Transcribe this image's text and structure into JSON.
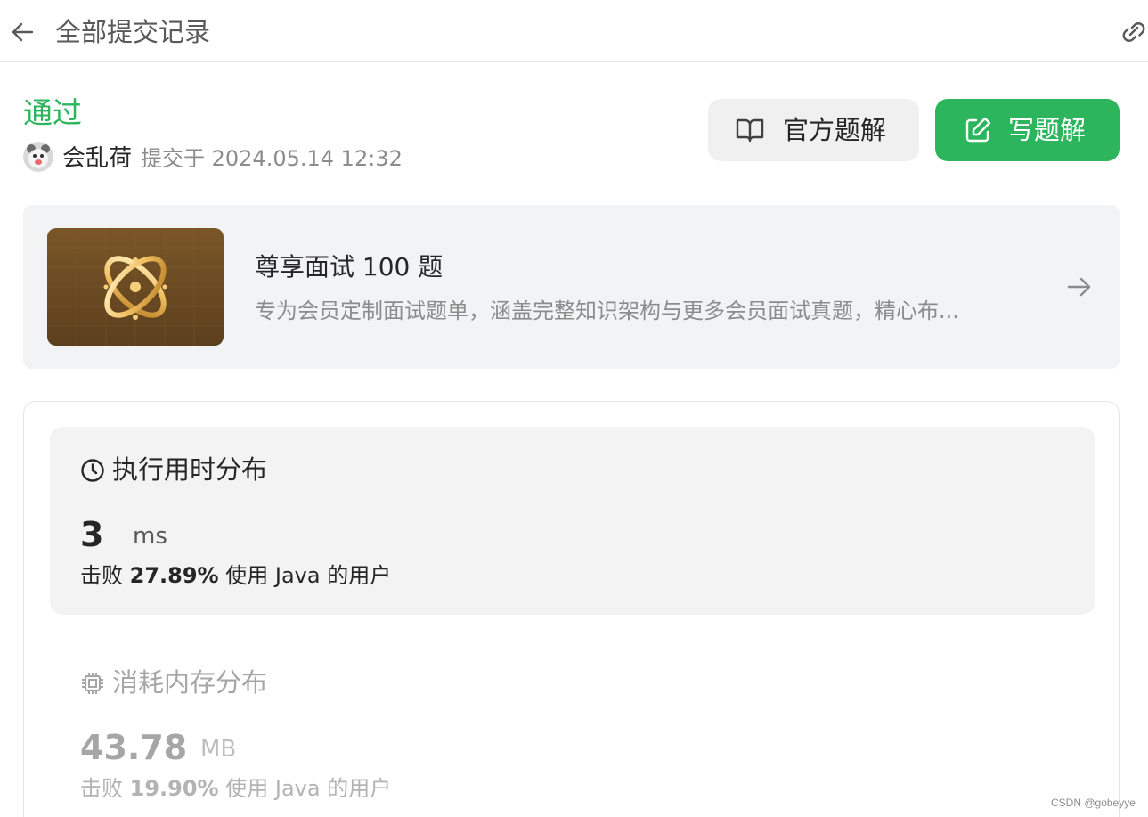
{
  "header": {
    "title": "全部提交记录",
    "back_icon": "arrow-left-icon",
    "share_icon": "link-icon"
  },
  "submission": {
    "status": "通过",
    "username": "会乱荷",
    "submitted_text": "提交于 2024.05.14 12:32"
  },
  "actions": {
    "official_solution_label": "官方题解",
    "write_solution_label": "写题解",
    "official_icon": "book-open-icon",
    "write_icon": "edit-icon"
  },
  "promo": {
    "title": "尊享面试 100 题",
    "description": "专为会员定制面试题单，涵盖完整知识架构与更多会员面试真题，精心布...",
    "arrow_icon": "arrow-right-icon"
  },
  "runtime": {
    "title": "执行用时分布",
    "value": "3",
    "unit": "ms",
    "beat_prefix": "击败",
    "beat_percent": "27.89%",
    "beat_suffix": "使用 Java 的用户",
    "icon": "clock-icon"
  },
  "memory": {
    "title": "消耗内存分布",
    "value": "43.78",
    "unit": "MB",
    "beat_prefix": "击败",
    "beat_percent": "19.90%",
    "beat_suffix": "使用 Java 的用户",
    "icon": "chip-icon"
  },
  "watermark": "CSDN @gobeyye",
  "colors": {
    "accent_green": "#2db55d",
    "panel_bg": "#f3f3f4"
  }
}
